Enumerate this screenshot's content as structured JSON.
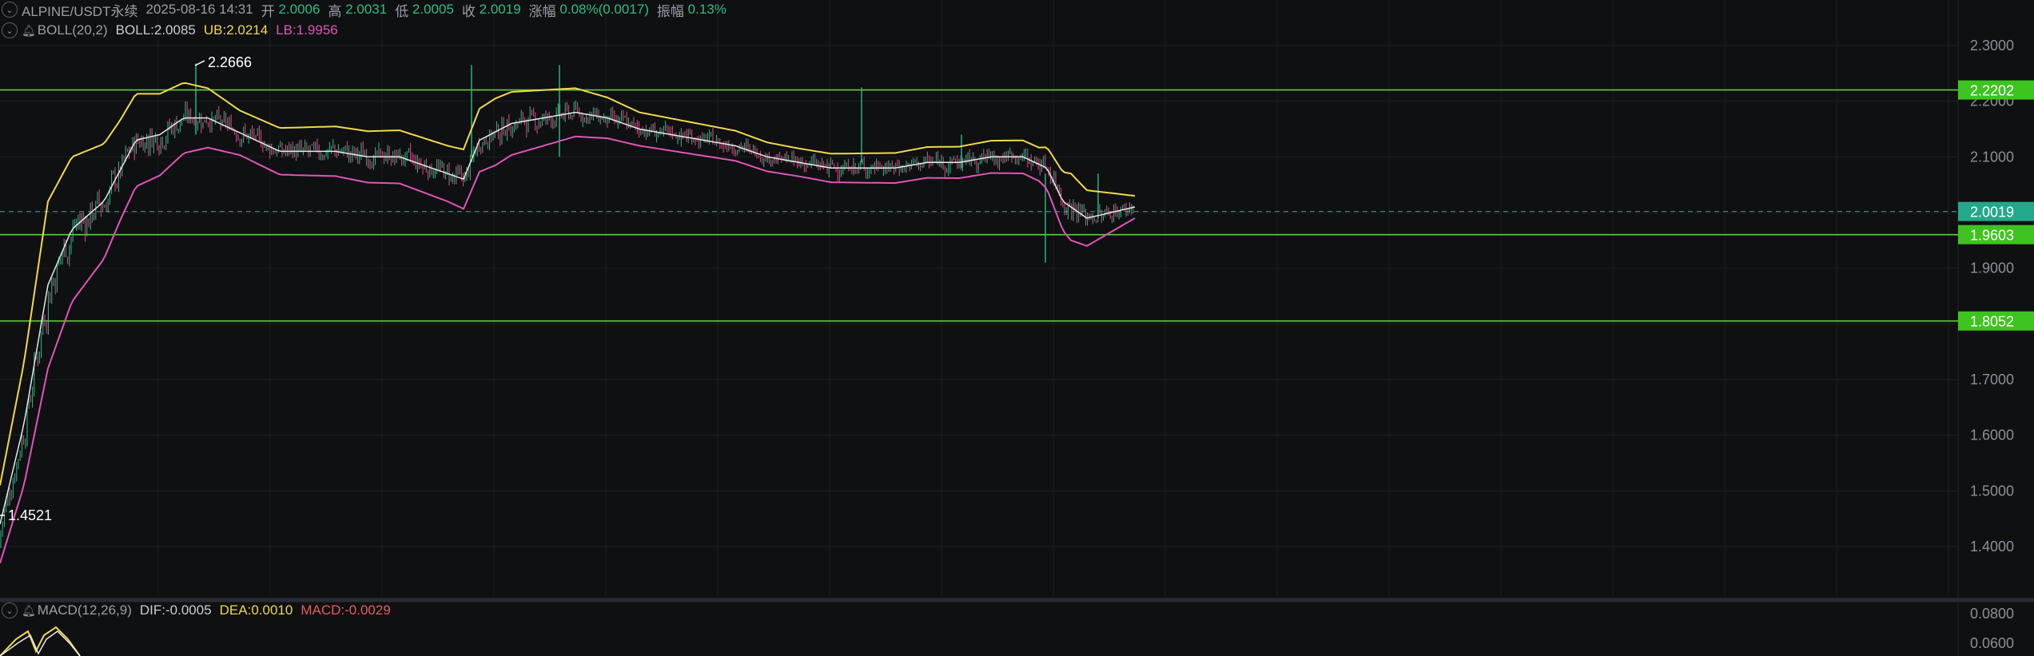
{
  "header": {
    "symbol": "ALPINE/USDT永续",
    "datetime": "2025-08-16 14:31",
    "open_label": "开",
    "open": "2.0006",
    "high_label": "高",
    "high": "2.0031",
    "low_label": "低",
    "low": "2.0005",
    "close_label": "收",
    "close": "2.0019",
    "change_label": "涨幅",
    "change": "0.08%(0.0017)",
    "amplitude_label": "振幅",
    "amplitude": "0.13%"
  },
  "boll": {
    "name": "BOLL(20,2)",
    "mid": "BOLL:2.0085",
    "ub": "UB:2.0214",
    "lb": "LB:1.9956"
  },
  "macd": {
    "name": "MACD(12,26,9)",
    "dif": "DIF:-0.0005",
    "dea": "DEA:0.0010",
    "macd": "MACD:-0.0029"
  },
  "price_axis": {
    "ticks": [
      "2.3000",
      "2.2000",
      "2.1000",
      "1.9000",
      "1.7000",
      "1.6000",
      "1.5000",
      "1.4000"
    ],
    "tick_values": [
      2.3,
      2.2,
      2.1,
      1.9,
      1.7,
      1.6,
      1.5,
      1.4
    ],
    "min": 1.33,
    "max": 2.33
  },
  "macd_axis": {
    "ticks": [
      "0.0800",
      "0.0600"
    ],
    "tick_values": [
      0.08,
      0.06
    ]
  },
  "annotations": {
    "high_marker": "2.2666",
    "low_marker": "1.4521"
  },
  "levels": [
    {
      "value": 2.2202,
      "label": "2.2202",
      "kind": "line"
    },
    {
      "value": 2.0019,
      "label": "2.0019",
      "kind": "current"
    },
    {
      "value": 1.9603,
      "label": "1.9603",
      "kind": "line"
    },
    {
      "value": 1.8052,
      "label": "1.8052",
      "kind": "line"
    }
  ],
  "colors": {
    "background": "#0f1012",
    "grid": "#1c1e22",
    "up": "#2ebd85",
    "down": "#e6478b",
    "level_line": "#5fcf3a",
    "level_label_bg": "#3ec41f",
    "current_label_bg": "#23a98a",
    "boll_mid": "#e8e8e8",
    "boll_ub": "#f0d84b",
    "boll_lb": "#e055b5"
  },
  "chart_data": {
    "type": "candlestick",
    "series_mid_path": [
      [
        0,
        1.44
      ],
      [
        30,
        1.62
      ],
      [
        60,
        1.87
      ],
      [
        90,
        1.97
      ],
      [
        130,
        2.02
      ],
      [
        170,
        2.13
      ],
      [
        200,
        2.14
      ],
      [
        230,
        2.17
      ],
      [
        260,
        2.17
      ],
      [
        290,
        2.15
      ],
      [
        320,
        2.13
      ],
      [
        350,
        2.11
      ],
      [
        380,
        2.11
      ],
      [
        420,
        2.11
      ],
      [
        460,
        2.1
      ],
      [
        500,
        2.1
      ],
      [
        540,
        2.08
      ],
      [
        580,
        2.06
      ],
      [
        600,
        2.13
      ],
      [
        640,
        2.16
      ],
      [
        680,
        2.17
      ],
      [
        720,
        2.18
      ],
      [
        760,
        2.17
      ],
      [
        800,
        2.15
      ],
      [
        840,
        2.14
      ],
      [
        880,
        2.13
      ],
      [
        920,
        2.12
      ],
      [
        960,
        2.1
      ],
      [
        1000,
        2.09
      ],
      [
        1040,
        2.08
      ],
      [
        1080,
        2.08
      ],
      [
        1120,
        2.08
      ],
      [
        1160,
        2.09
      ],
      [
        1200,
        2.09
      ],
      [
        1240,
        2.1
      ],
      [
        1280,
        2.1
      ],
      [
        1310,
        2.08
      ],
      [
        1330,
        2.02
      ],
      [
        1360,
        1.99
      ],
      [
        1390,
        2.0
      ],
      [
        1420,
        2.01
      ]
    ],
    "band_width": [
      [
        0,
        0.07
      ],
      [
        60,
        0.15
      ],
      [
        150,
        0.09
      ],
      [
        300,
        0.04
      ],
      [
        560,
        0.05
      ],
      [
        620,
        0.06
      ],
      [
        800,
        0.03
      ],
      [
        1000,
        0.025
      ],
      [
        1300,
        0.03
      ],
      [
        1340,
        0.06
      ],
      [
        1420,
        0.02
      ]
    ]
  }
}
